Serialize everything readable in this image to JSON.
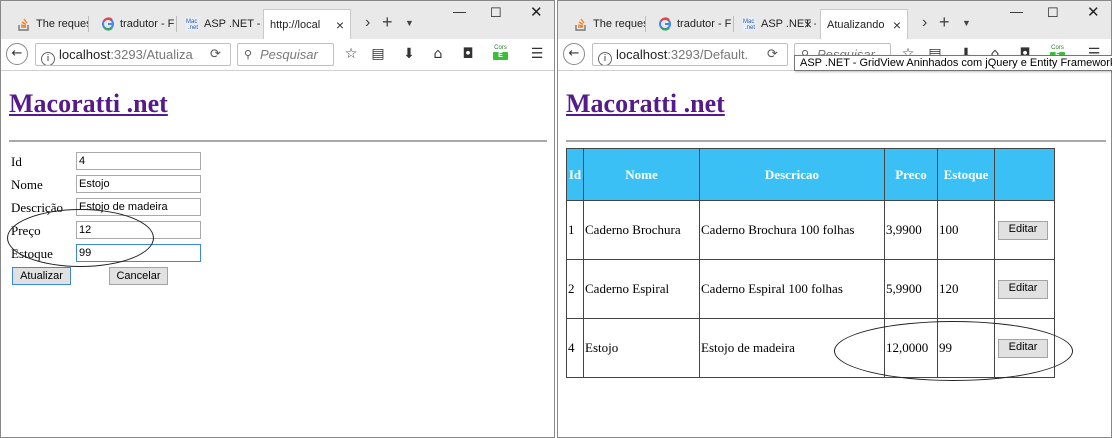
{
  "left_window": {
    "tabs": [
      {
        "label": "The reques",
        "favicon": "stack-overflow-icon"
      },
      {
        "label": "tradutor - F",
        "favicon": "google-icon"
      },
      {
        "label": "ASP .NET -",
        "favicon": "macoratti-icon"
      },
      {
        "label": "http://local",
        "favicon": "none"
      }
    ],
    "url": {
      "host": "localhost",
      "path": ":3293/Atualiza"
    },
    "search_placeholder": "Pesquisar",
    "title": "Macoratti .net",
    "form": {
      "fields": [
        {
          "label": "Id",
          "value": "4"
        },
        {
          "label": "Nome",
          "value": "Estojo"
        },
        {
          "label": "Descrição",
          "value": "Estojo de madeira"
        },
        {
          "label": "Preço",
          "value": "12"
        },
        {
          "label": "Estoque",
          "value": "99"
        }
      ],
      "update_label": "Atualizar",
      "cancel_label": "Cancelar"
    }
  },
  "right_window": {
    "tabs": [
      {
        "label": "The reques",
        "favicon": "stack-overflow-icon"
      },
      {
        "label": "tradutor - F",
        "favicon": "google-icon"
      },
      {
        "label": "ASP .NET -",
        "favicon": "macoratti-icon"
      },
      {
        "label": "Atualizando",
        "favicon": "none"
      }
    ],
    "url": {
      "host": "localhost",
      "path": ":3293/Default."
    },
    "search_placeholder": "Pesquisar",
    "tooltip": "ASP .NET - GridView Aninhados com jQuery e Entity Framework",
    "title": "Macoratti .net",
    "grid": {
      "columns": [
        "Id",
        "Nome",
        "Descricao",
        "Preco",
        "Estoque",
        ""
      ],
      "rows": [
        {
          "id": "1",
          "nome": "Caderno Brochura",
          "descricao": "Caderno Brochura 100 folhas",
          "preco": "3,9900",
          "estoque": "100",
          "action": "Editar"
        },
        {
          "id": "2",
          "nome": "Caderno Espiral",
          "descricao": "Caderno Espiral 100 folhas",
          "preco": "5,9900",
          "estoque": "120",
          "action": "Editar"
        },
        {
          "id": "4",
          "nome": "Estojo",
          "descricao": "Estojo de madeira",
          "preco": "12,0000",
          "estoque": "99",
          "action": "Editar"
        }
      ]
    }
  },
  "toolbar": {
    "cors_label": "Cors",
    "cors_badge": "E"
  },
  "colors": {
    "link": "#551a8b",
    "grid_header": "#3bc0f5",
    "focus": "#3b89d8"
  }
}
